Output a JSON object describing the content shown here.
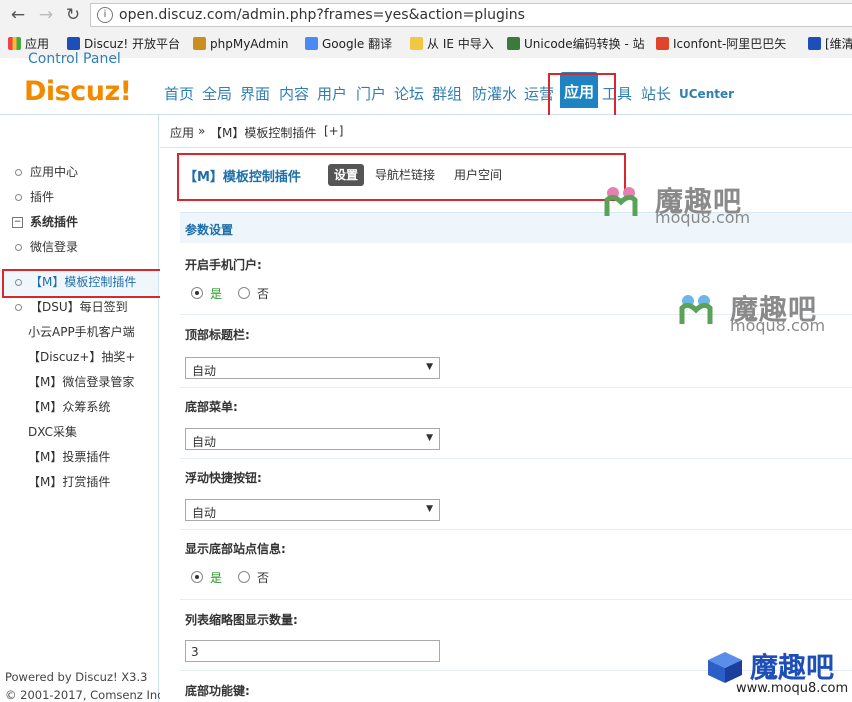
{
  "browser": {
    "url": "open.discuz.com/admin.php?frames=yes&action=plugins",
    "bookmarks": [
      {
        "label": "应用",
        "color": "#4a7bd6"
      },
      {
        "label": "Discuz! 开放平台",
        "color": "#1e4fb8"
      },
      {
        "label": "phpMyAdmin",
        "color": "#c98f1f"
      },
      {
        "label": "Google 翻译",
        "color": "#4a8af4"
      },
      {
        "label": "从 IE 中导入",
        "color": "#f2c744"
      },
      {
        "label": "Unicode编码转换 - 站",
        "color": "#3a7a3a"
      },
      {
        "label": "Iconfont-阿里巴巴矢",
        "color": "#e0452c"
      },
      {
        "label": "[维清",
        "color": "#1e4fb8"
      }
    ]
  },
  "header": {
    "logo": "Discuz!",
    "logo_sub": "Control Panel",
    "nav": [
      "首页",
      "全局",
      "界面",
      "内容",
      "用户",
      "门户",
      "论坛",
      "群组",
      "防灌水",
      "运营",
      "应用",
      "工具",
      "站长",
      "UCenter"
    ],
    "active_nav": "应用"
  },
  "breadcrumb": {
    "root": "应用",
    "sep": "»",
    "current": "【M】模板控制插件",
    "add": "[+]"
  },
  "sidebar": {
    "items": [
      {
        "label": "应用中心",
        "type": "item"
      },
      {
        "label": "插件",
        "type": "item"
      },
      {
        "label": "系统插件",
        "type": "group"
      },
      {
        "label": "微信登录",
        "type": "item"
      },
      {
        "label": "【M】模板控制插件",
        "type": "active"
      },
      {
        "label": "【DSU】每日签到",
        "type": "item"
      },
      {
        "label": "小云APP手机客户端",
        "type": "item"
      },
      {
        "label": "【Discuz+】抽奖+",
        "type": "item"
      },
      {
        "label": "【M】微信登录管家",
        "type": "item"
      },
      {
        "label": "【M】众筹系统",
        "type": "item"
      },
      {
        "label": "DXC采集",
        "type": "item"
      },
      {
        "label": "【M】投票插件",
        "type": "item"
      },
      {
        "label": "【M】打赏插件",
        "type": "item"
      }
    ],
    "footer_1": "Powered by Discuz! X3.3",
    "footer_2": "© 2001-2017, Comsenz Inc."
  },
  "plugin": {
    "title": "【M】模板控制插件",
    "tabs": [
      "设置",
      "导航栏链接",
      "用户空间"
    ],
    "section": "参数设置",
    "fields": [
      {
        "label": "开启手机门户:",
        "type": "radio",
        "yes": "是",
        "no": "否",
        "value": "yes"
      },
      {
        "label": "顶部标题栏:",
        "type": "select",
        "value": "自动"
      },
      {
        "label": "底部菜单:",
        "type": "select",
        "value": "自动"
      },
      {
        "label": "浮动快捷按钮:",
        "type": "select",
        "value": "自动"
      },
      {
        "label": "显示底部站点信息:",
        "type": "radio",
        "yes": "是",
        "no": "否",
        "value": "yes"
      },
      {
        "label": "列表缩略图显示数量:",
        "type": "text",
        "value": "3"
      },
      {
        "label": "底部功能键:",
        "type": "label"
      }
    ]
  },
  "watermarks": {
    "text": "魔趣吧",
    "domain": "moqu8.com",
    "domain_www": "www.moqu8.com"
  },
  "colors": {
    "brand_orange": "#f08a00",
    "link_blue": "#2f7fb3",
    "active_blue": "#1e83c2",
    "highlight_red": "#d9272e"
  }
}
